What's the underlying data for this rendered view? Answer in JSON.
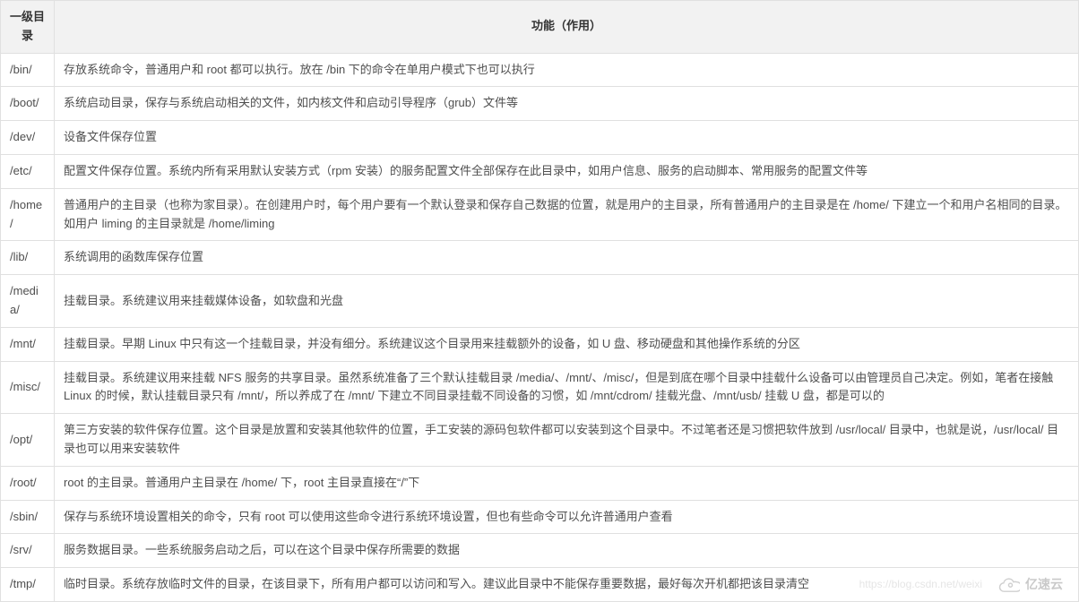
{
  "table": {
    "headers": {
      "col1": "一级目录",
      "col2": "功能（作用）"
    },
    "rows": [
      {
        "dir": "/bin/",
        "desc": "存放系统命令，普通用户和 root 都可以执行。放在 /bin 下的命令在单用户模式下也可以执行"
      },
      {
        "dir": "/boot/",
        "desc": "系统启动目录，保存与系统启动相关的文件，如内核文件和启动引导程序（grub）文件等"
      },
      {
        "dir": "/dev/",
        "desc": "设备文件保存位置"
      },
      {
        "dir": "/etc/",
        "desc": "配置文件保存位置。系统内所有采用默认安装方式（rpm 安装）的服务配置文件全部保存在此目录中，如用户信息、服务的启动脚本、常用服务的配置文件等"
      },
      {
        "dir": "/home/",
        "desc": "普通用户的主目录（也称为家目录）。在创建用户时，每个用户要有一个默认登录和保存自己数据的位置，就是用户的主目录，所有普通用户的主目录是在 /home/ 下建立一个和用户名相同的目录。如用户 liming 的主目录就是 /home/liming"
      },
      {
        "dir": "/lib/",
        "desc": "系统调用的函数库保存位置"
      },
      {
        "dir": "/media/",
        "desc": "挂载目录。系统建议用来挂载媒体设备，如软盘和光盘"
      },
      {
        "dir": "/mnt/",
        "desc": "挂载目录。早期 Linux 中只有这一个挂载目录，并没有细分。系统建议这个目录用来挂载额外的设备，如 U 盘、移动硬盘和其他操作系统的分区"
      },
      {
        "dir": "/misc/",
        "desc": "挂载目录。系统建议用来挂载 NFS 服务的共享目录。虽然系统准备了三个默认挂载目录 /media/、/mnt/、/misc/，但是到底在哪个目录中挂载什么设备可以由管理员自己决定。例如，笔者在接触 Linux 的时候，默认挂载目录只有 /mnt/，所以养成了在 /mnt/ 下建立不同目录挂载不同设备的习惯，如 /mnt/cdrom/ 挂载光盘、/mnt/usb/ 挂载 U 盘，都是可以的"
      },
      {
        "dir": "/opt/",
        "desc": "第三方安装的软件保存位置。这个目录是放置和安装其他软件的位置，手工安装的源码包软件都可以安装到这个目录中。不过笔者还是习惯把软件放到 /usr/local/ 目录中，也就是说，/usr/local/ 目录也可以用来安装软件"
      },
      {
        "dir": "/root/",
        "desc": "root 的主目录。普通用户主目录在 /home/ 下，root 主目录直接在“/”下"
      },
      {
        "dir": "/sbin/",
        "desc": "保存与系统环境设置相关的命令，只有 root 可以使用这些命令进行系统环境设置，但也有些命令可以允许普通用户查看"
      },
      {
        "dir": "/srv/",
        "desc": "服务数据目录。一些系统服务启动之后，可以在这个目录中保存所需要的数据"
      },
      {
        "dir": "/tmp/",
        "desc": "临时目录。系统存放临时文件的目录，在该目录下，所有用户都可以访问和写入。建议此目录中不能保存重要数据，最好每次开机都把该目录清空"
      }
    ]
  },
  "watermark": {
    "url": "https://blog.csdn.net/weixi",
    "brand": "亿速云"
  }
}
